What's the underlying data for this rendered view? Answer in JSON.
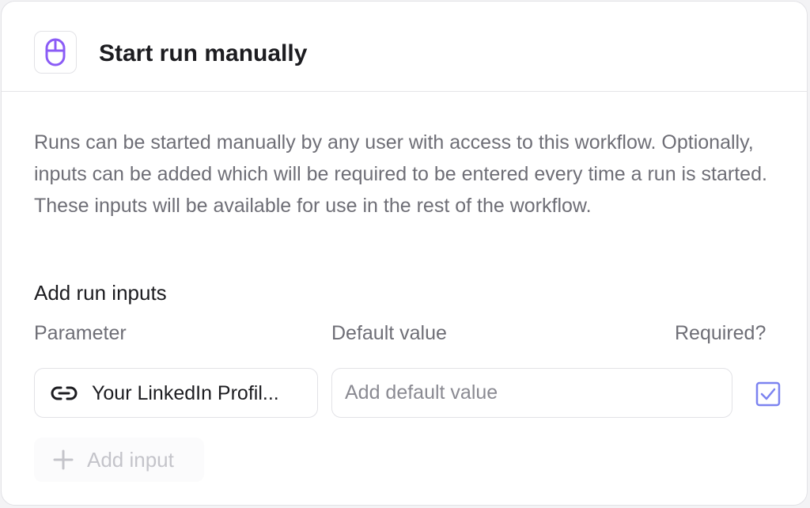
{
  "header": {
    "title": "Start run manually",
    "icon": "mouse-icon",
    "icon_color": "#8b5cf6"
  },
  "description": "Runs can be started manually by any user with access to this workflow. Optionally, inputs can be added which will be required to be entered every time a run is started. These inputs will be available for use in the rest of the workflow.",
  "inputs_section": {
    "title": "Add run inputs",
    "columns": {
      "parameter": "Parameter",
      "default_value": "Default value",
      "required": "Required?"
    },
    "rows": [
      {
        "icon": "link-icon",
        "parameter": "Your LinkedIn Profil...",
        "default_value": "",
        "default_placeholder": "Add default value",
        "required": true
      }
    ],
    "add_button_label": "Add input"
  },
  "colors": {
    "checkbox_accent": "#7c83f0",
    "text_primary": "#1c1c20",
    "text_secondary": "#6e6e76",
    "disabled": "#c4c4ca"
  }
}
